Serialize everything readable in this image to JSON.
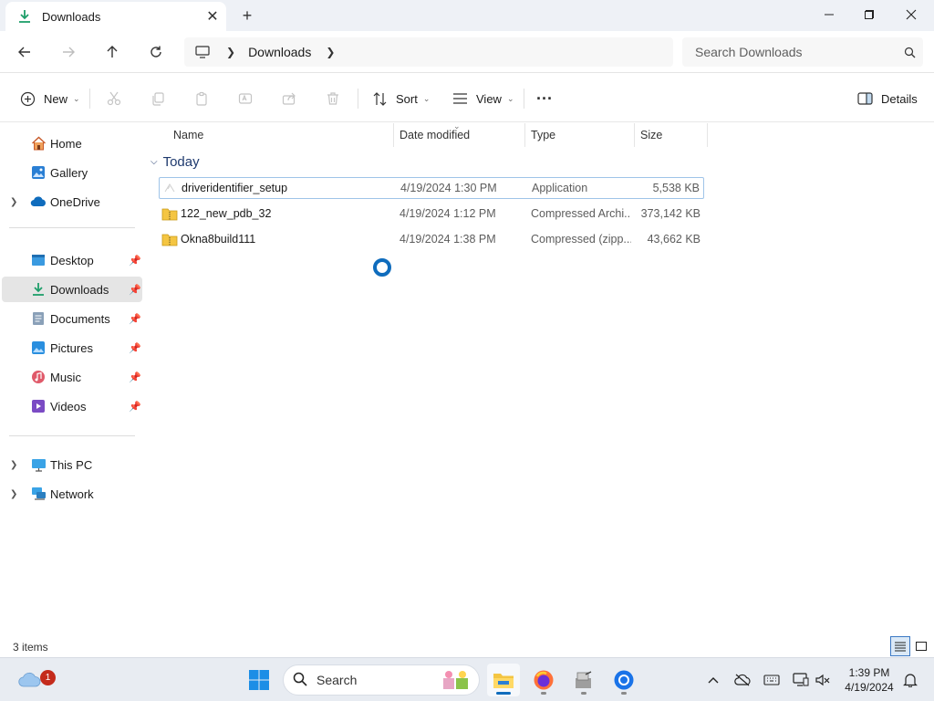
{
  "window": {
    "tab_title": "Downloads",
    "new_tab_symbol": "+",
    "close_tab_symbol": "✕"
  },
  "address": {
    "crumbs": [
      "Downloads"
    ],
    "search_placeholder": "Search Downloads"
  },
  "command_bar": {
    "new_label": "New",
    "sort_label": "Sort",
    "view_label": "View",
    "more_label": "···",
    "details_label": "Details"
  },
  "sidebar": {
    "items": [
      {
        "label": "Home",
        "icon": "home-icon"
      },
      {
        "label": "Gallery",
        "icon": "gallery-icon"
      },
      {
        "label": "OneDrive",
        "icon": "cloud-icon"
      },
      {
        "label": "Desktop",
        "icon": "desktop-icon"
      },
      {
        "label": "Downloads",
        "icon": "download-icon"
      },
      {
        "label": "Documents",
        "icon": "documents-icon"
      },
      {
        "label": "Pictures",
        "icon": "pictures-icon"
      },
      {
        "label": "Music",
        "icon": "music-icon"
      },
      {
        "label": "Videos",
        "icon": "videos-icon"
      },
      {
        "label": "This PC",
        "icon": "pc-icon"
      },
      {
        "label": "Network",
        "icon": "network-icon"
      }
    ]
  },
  "file_list": {
    "columns": [
      "Name",
      "Date modified",
      "Type",
      "Size"
    ],
    "group_label": "Today",
    "rows": [
      {
        "name": "driveridentifier_setup",
        "date": "4/19/2024 1:30 PM",
        "type": "Application",
        "size": "5,538 KB"
      },
      {
        "name": "122_new_pdb_32",
        "date": "4/19/2024 1:12 PM",
        "type": "Compressed Archi...",
        "size": "373,142 KB"
      },
      {
        "name": "Okna8build111",
        "date": "4/19/2024 1:38 PM",
        "type": "Compressed (zipp...",
        "size": "43,662 KB"
      }
    ]
  },
  "status": {
    "item_count": "3 items"
  },
  "taskbar": {
    "search_label": "Search",
    "notification_badge": "1",
    "time": "1:39 PM",
    "date": "4/19/2024"
  },
  "colors": {
    "accent": "#0f6cbd",
    "folder": "#f4c542",
    "selected_nav": "#e5e5e5"
  }
}
